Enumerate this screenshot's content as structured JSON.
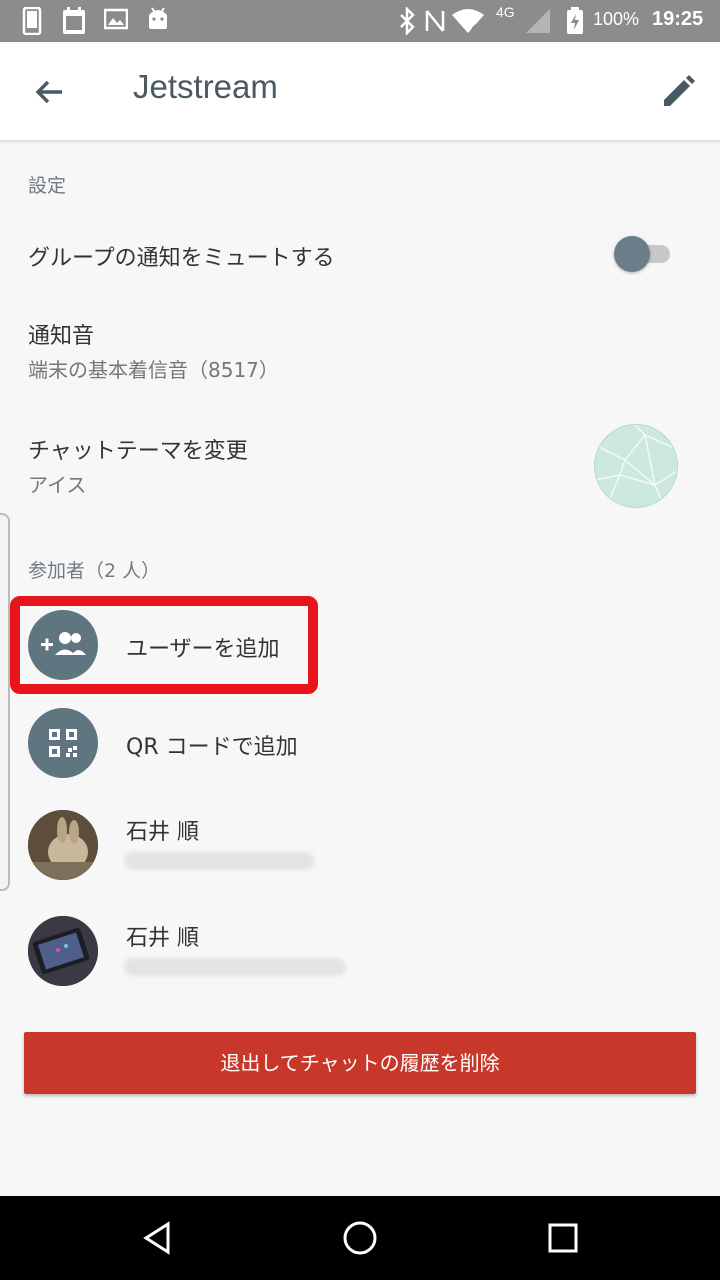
{
  "status_bar": {
    "battery": "100%",
    "time": "19:25",
    "network": "4G",
    "icons": [
      "phone-icon",
      "calendar-100-icon",
      "image-icon",
      "android-icon",
      "bluetooth-icon",
      "nfc-icon",
      "wifi-icon",
      "signal-icon",
      "battery-charging-icon"
    ]
  },
  "app_bar": {
    "title": "Jetstream",
    "back_icon": "arrow-left-icon",
    "edit_icon": "pencil-icon"
  },
  "settings": {
    "section_label": "設定",
    "mute_label": "グループの通知をミュートする",
    "mute_enabled": false,
    "sound_title": "通知音",
    "sound_value": "端末の基本着信音（8517）",
    "theme_title": "チャットテーマを変更",
    "theme_value": "アイス"
  },
  "participants": {
    "section_label": "参加者（2 人）",
    "add_user": "ユーザーを追加",
    "add_qr": "QR コードで追加",
    "members": [
      {
        "name": "石井 順"
      },
      {
        "name": "石井 順"
      }
    ]
  },
  "leave_button": "退出してチャットの履歴を削除",
  "colors": {
    "accent_red": "#c8382a",
    "highlight_red": "#e8141b",
    "icon_slate": "#5f7580"
  }
}
